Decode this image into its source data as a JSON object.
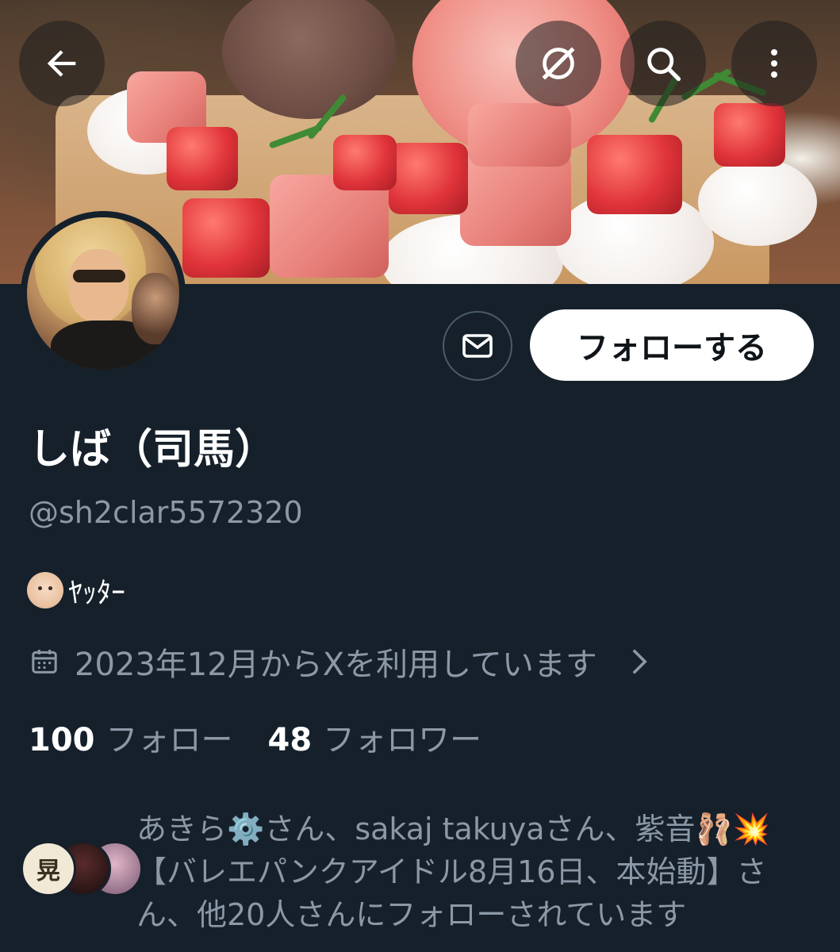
{
  "header": {
    "back_icon": "arrow-left-icon",
    "grok_icon": "grok-icon",
    "search_icon": "search-icon",
    "more_icon": "more-vertical-icon"
  },
  "banner": {
    "description_icon": "banner-image"
  },
  "actions": {
    "message_icon": "mail-icon",
    "follow_label": "フォローする"
  },
  "profile": {
    "name": "しば（司馬）",
    "handle": "@sh2clar5572320",
    "bio_text": "ﾔｯﾀｰ",
    "joined": "2023年12月からXを利用しています",
    "following_count": "100",
    "following_label": "フォロー",
    "followers_count": "48",
    "followers_label": "フォロワー"
  },
  "followed_by": {
    "first_avatar_text": "晃",
    "text": "あきら⚙️さん、sakaj takuyaさん、紫音🩰💥【バレエパンクアイドル8月16日、本始動】さん、他20人さんにフォローされています"
  },
  "colors": {
    "background": "#15202b",
    "secondary_text": "#8b98a5",
    "button_bg": "#ffffff"
  }
}
